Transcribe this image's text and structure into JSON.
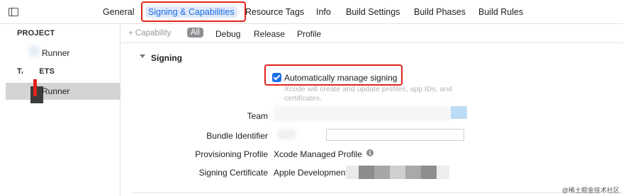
{
  "tabs": [
    {
      "label": "General"
    },
    {
      "label": "Signing & Capabilities",
      "active": true
    },
    {
      "label": "Resource Tags"
    },
    {
      "label": "Info"
    },
    {
      "label": "Build Settings"
    },
    {
      "label": "Build Phases"
    },
    {
      "label": "Build Rules"
    }
  ],
  "sidebar": {
    "project_header": "PROJECT",
    "project_item": "Runner",
    "targets_header": "TARGETS",
    "target_item": "Runner"
  },
  "filterbar": {
    "add_capability": "+ Capability",
    "segments": [
      "All",
      "Debug",
      "Release",
      "Profile"
    ]
  },
  "signing": {
    "section_title": "Signing",
    "auto_manage_label": "Automatically manage signing",
    "auto_manage_checked": true,
    "helper_text": "Xcode will create and update profiles, app IDs, and certificates.",
    "team_label": "Team",
    "bundle_id_label": "Bundle Identifier",
    "provisioning_label": "Provisioning Profile",
    "provisioning_value": "Xcode Managed Profile",
    "certificate_label": "Signing Certificate",
    "certificate_value": "Apple Development"
  },
  "watermark": "@稀土掘金技术社区",
  "colors": {
    "accent": "#1a6fe8",
    "annotation_red": "#e2231a"
  }
}
